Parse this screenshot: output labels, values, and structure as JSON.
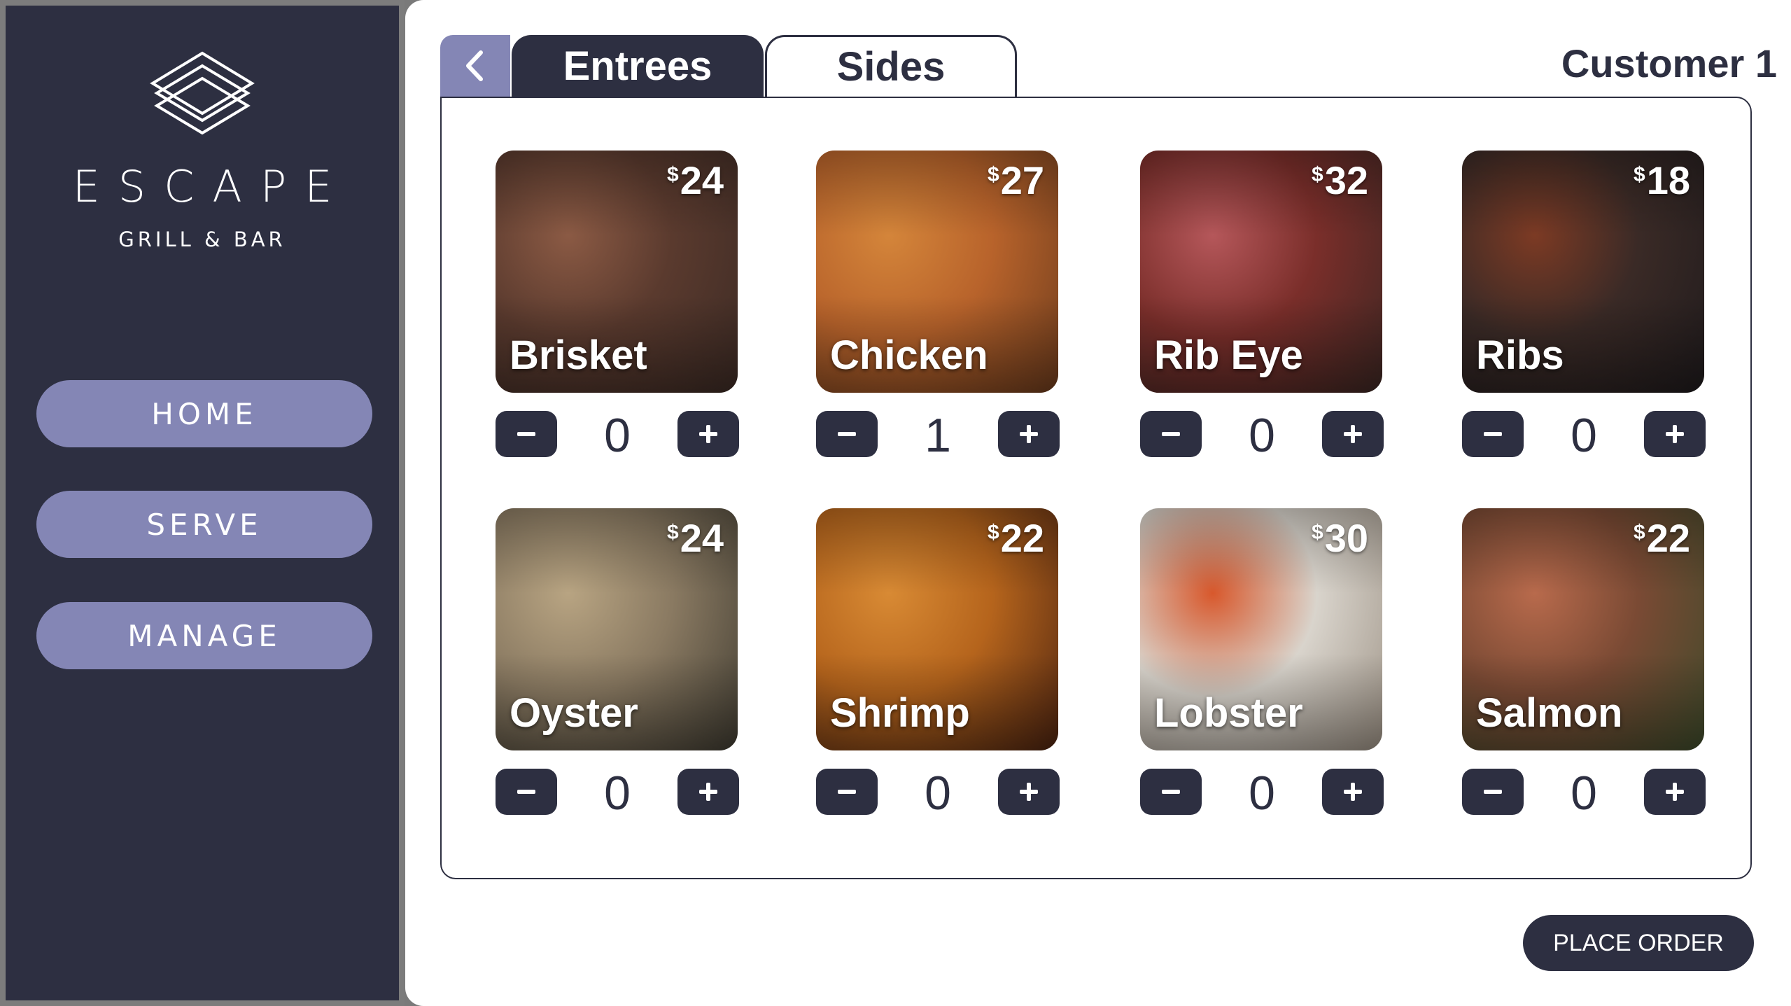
{
  "brand": {
    "name": "ESCAPE",
    "tagline": "GRILL & BAR",
    "logo_icon": "layered-diamond-logo"
  },
  "sidebar": {
    "items": [
      {
        "label": "HOME"
      },
      {
        "label": "SERVE"
      },
      {
        "label": "MANAGE"
      }
    ]
  },
  "tabs": {
    "back_icon": "chevron-left-icon",
    "entrees": "Entrees",
    "sides": "Sides",
    "active": "Entrees"
  },
  "customer": "Customer 1",
  "currency_symbol": "$",
  "menu_items": [
    {
      "name": "Brisket",
      "price": "24",
      "qty": "0",
      "photo_colors": [
        "#5a3a2e",
        "#8b5a44",
        "#3b2a24"
      ]
    },
    {
      "name": "Chicken",
      "price": "27",
      "qty": "1",
      "photo_colors": [
        "#b8632b",
        "#d4853a",
        "#6a3a1c"
      ]
    },
    {
      "name": "Rib Eye",
      "price": "32",
      "qty": "0",
      "photo_colors": [
        "#7a2e2a",
        "#b5575a",
        "#3a2622"
      ]
    },
    {
      "name": "Ribs",
      "price": "18",
      "qty": "0",
      "photo_colors": [
        "#3a2a26",
        "#7c3a24",
        "#1e1a1c"
      ]
    },
    {
      "name": "Oyster",
      "price": "24",
      "qty": "0",
      "photo_colors": [
        "#8a7a62",
        "#b8a482",
        "#3e3a30"
      ]
    },
    {
      "name": "Shrimp",
      "price": "22",
      "qty": "0",
      "photo_colors": [
        "#b5641c",
        "#d88a34",
        "#4a2210"
      ]
    },
    {
      "name": "Lobster",
      "price": "30",
      "qty": "0",
      "photo_colors": [
        "#d9d4cc",
        "#d8582c",
        "#9a8f82"
      ]
    },
    {
      "name": "Salmon",
      "price": "22",
      "qty": "0",
      "photo_colors": [
        "#7a4a34",
        "#b86a4c",
        "#3c4a2a"
      ]
    }
  ],
  "stepper": {
    "minus_icon": "minus-icon",
    "plus_icon": "plus-icon"
  },
  "place_order_label": "PLACE ORDER",
  "colors": {
    "navy": "#2d2f41",
    "lavender": "#8486b5",
    "frame": "#7c7c7c"
  }
}
